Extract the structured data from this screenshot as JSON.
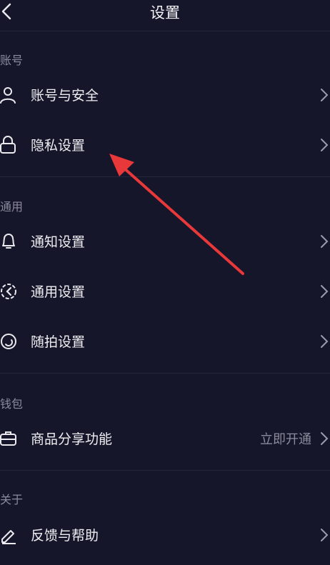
{
  "header": {
    "title": "设置"
  },
  "sections": [
    {
      "label": "账号",
      "items": [
        {
          "label": "账号与安全",
          "icon": "person-icon"
        },
        {
          "label": "隐私设置",
          "icon": "lock-icon"
        }
      ]
    },
    {
      "label": "通用",
      "items": [
        {
          "label": "通知设置",
          "icon": "bell-icon"
        },
        {
          "label": "通用设置",
          "icon": "gear-icon"
        },
        {
          "label": "随拍设置",
          "icon": "camera-circle-icon"
        }
      ]
    },
    {
      "label": "钱包",
      "items": [
        {
          "label": "商品分享功能",
          "value": "立即开通",
          "icon": "briefcase-icon"
        }
      ]
    },
    {
      "label": "关于",
      "items": [
        {
          "label": "反馈与帮助",
          "icon": "pencil-icon"
        }
      ]
    }
  ],
  "colors": {
    "background": "#15162a",
    "divider": "#25263a",
    "muted_text": "#8a8b9b",
    "annotation_arrow": "#e8383a"
  }
}
